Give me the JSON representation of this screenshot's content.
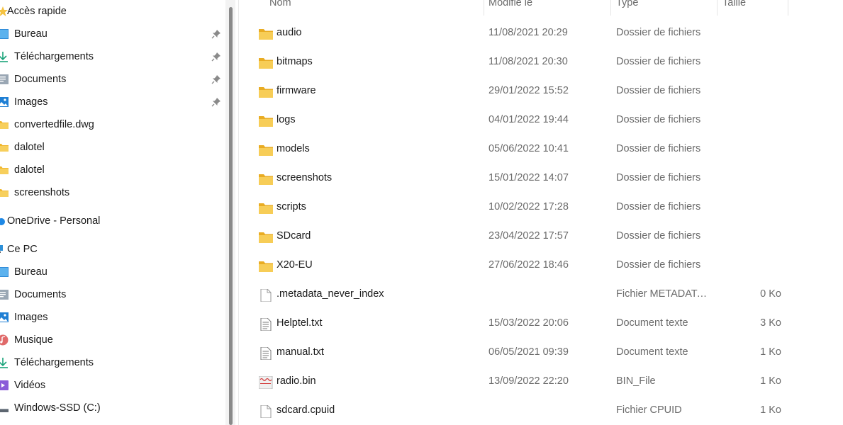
{
  "sidebar": {
    "quick_access": "Accès rapide",
    "items": [
      {
        "label": "Bureau",
        "icon": "desktop-icon",
        "pinned": true
      },
      {
        "label": "Téléchargements",
        "icon": "download-icon",
        "pinned": true
      },
      {
        "label": "Documents",
        "icon": "documents-icon",
        "pinned": true
      },
      {
        "label": "Images",
        "icon": "images-icon",
        "pinned": true
      },
      {
        "label": "convertedfile.dwg",
        "icon": "folder-icon",
        "pinned": false
      },
      {
        "label": "dalotel",
        "icon": "folder-icon",
        "pinned": false
      },
      {
        "label": "dalotel",
        "icon": "folder-icon",
        "pinned": false
      },
      {
        "label": "screenshots",
        "icon": "folder-icon",
        "pinned": false
      }
    ],
    "onedrive": "OneDrive - Personal",
    "this_pc": "Ce PC",
    "pc_items": [
      {
        "label": "Bureau",
        "icon": "desktop-icon"
      },
      {
        "label": "Documents",
        "icon": "documents-icon"
      },
      {
        "label": "Images",
        "icon": "images-icon"
      },
      {
        "label": "Musique",
        "icon": "music-icon"
      },
      {
        "label": "Téléchargements",
        "icon": "download-icon"
      },
      {
        "label": "Vidéos",
        "icon": "videos-icon"
      },
      {
        "label": "Windows-SSD (C:)",
        "icon": "drive-icon"
      }
    ]
  },
  "columns": {
    "name": "Nom",
    "modified": "Modifié le",
    "type": "Type",
    "size": "Taille"
  },
  "files": [
    {
      "name": "audio",
      "date": "11/08/2021 20:29",
      "type": "Dossier de fichiers",
      "size": "",
      "icon": "folder-icon"
    },
    {
      "name": "bitmaps",
      "date": "11/08/2021 20:30",
      "type": "Dossier de fichiers",
      "size": "",
      "icon": "folder-icon"
    },
    {
      "name": "firmware",
      "date": "29/01/2022 15:52",
      "type": "Dossier de fichiers",
      "size": "",
      "icon": "folder-icon"
    },
    {
      "name": "logs",
      "date": "04/01/2022 19:44",
      "type": "Dossier de fichiers",
      "size": "",
      "icon": "folder-icon"
    },
    {
      "name": "models",
      "date": "05/06/2022 10:41",
      "type": "Dossier de fichiers",
      "size": "",
      "icon": "folder-icon"
    },
    {
      "name": "screenshots",
      "date": "15/01/2022 14:07",
      "type": "Dossier de fichiers",
      "size": "",
      "icon": "folder-icon"
    },
    {
      "name": "scripts",
      "date": "10/02/2022 17:28",
      "type": "Dossier de fichiers",
      "size": "",
      "icon": "folder-icon"
    },
    {
      "name": "SDcard",
      "date": "23/04/2022 17:57",
      "type": "Dossier de fichiers",
      "size": "",
      "icon": "folder-icon"
    },
    {
      "name": "X20-EU",
      "date": "27/06/2022 18:46",
      "type": "Dossier de fichiers",
      "size": "",
      "icon": "folder-icon"
    },
    {
      "name": ".metadata_never_index",
      "date": "",
      "type": "Fichier METADATA...",
      "size": "0 Ko",
      "icon": "blank-file-icon"
    },
    {
      "name": "Helptel.txt",
      "date": "15/03/2022 20:06",
      "type": "Document texte",
      "size": "3 Ko",
      "icon": "text-file-icon"
    },
    {
      "name": "manual.txt",
      "date": "06/05/2021 09:39",
      "type": "Document texte",
      "size": "1 Ko",
      "icon": "text-file-icon"
    },
    {
      "name": "radio.bin",
      "date": "13/09/2022 22:20",
      "type": "BIN_File",
      "size": "1 Ko",
      "icon": "bin-file-icon"
    },
    {
      "name": "sdcard.cpuid",
      "date": "",
      "type": "Fichier CPUID",
      "size": "1 Ko",
      "icon": "blank-file-icon"
    }
  ],
  "colors": {
    "folder": "#f5c342",
    "accent": "#0078d4"
  }
}
